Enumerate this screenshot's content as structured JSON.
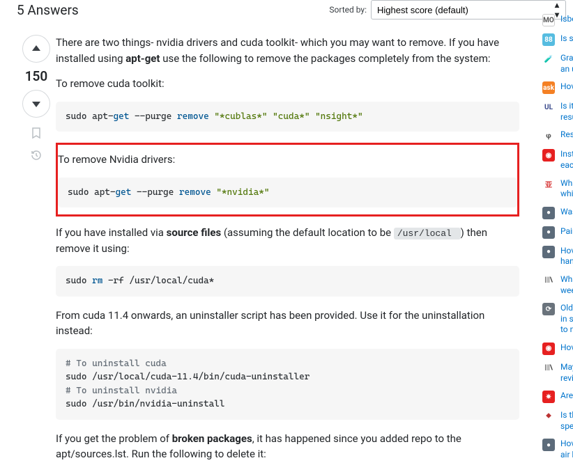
{
  "header": {
    "title": "5 Answers",
    "sort_label": "Sorted by:",
    "sort_value": "Highest score (default)"
  },
  "vote": {
    "count": "150"
  },
  "answer": {
    "p1a": "There are two things- nvidia drivers and cuda toolkit- which you may want to remove. If you have installed using ",
    "p1b": "apt-get",
    "p1c": " use the following to remove the packages completely from the system:",
    "p2": "To remove cuda toolkit:",
    "code1": "sudo apt-<blue>get</blue> --purge <kw>remove</kw> <str>\"*cublas*\"</str> <str>\"cuda*\"</str> <str>\"nsight*\"</str>",
    "p3": "To remove Nvidia drivers:",
    "code2": "sudo apt-<blue>get</blue> --purge <kw>remove</kw> <str>\"*nvidia*\"</str>",
    "p4a": "If you have installed via ",
    "p4b": "source files",
    "p4c": " (assuming the default location to be ",
    "p4code": " /usr/local ",
    "p4d": ") then remove it using:",
    "code3": "sudo <kw>rm</kw> -rf /usr/local/cuda*",
    "p5": "From cuda 11.4 onwards, an uninstaller script has been provided. Use it for the uninstallation instead:",
    "code4": "<cmt># To uninstall cuda</cmt>\nsudo /usr/local/cuda-11.4/bin/cuda-uninstaller\n<cmt># To uninstall nvidia</cmt>\nsudo /usr/bin/nvidia-uninstall",
    "p6a": "If you get the problem of ",
    "p6b": "broken packages",
    "p6c": ", it has happened since you added repo to the apt/sources.lst. Run the following to delete it:"
  },
  "related": [
    {
      "icon_bg": "#fff",
      "icon_border": "1px solid #ccc",
      "icon_fg": "#555",
      "icon_text": "MO",
      "l1": "Isbe",
      "l2": ""
    },
    {
      "icon_bg": "#56bce0",
      "icon_fg": "#fff",
      "icon_text": "88",
      "l1": "Is sa",
      "l2": ""
    },
    {
      "icon_bg": "#fff",
      "icon_fg": "#777",
      "icon_text": "🧪",
      "l1": "Gra",
      "l2": "an u"
    },
    {
      "icon_bg": "#f48024",
      "icon_fg": "#fff",
      "icon_text": "ask",
      "l1": "Hov",
      "l2": ""
    },
    {
      "icon_bg": "#fff",
      "icon_fg": "#3a4a8c",
      "icon_text": "UL",
      "l1": "Is it",
      "l2": "resu"
    },
    {
      "icon_bg": "#fff",
      "icon_fg": "#555",
      "icon_text": "φ",
      "l1": "Rese",
      "l2": ""
    },
    {
      "icon_bg": "#e62020",
      "icon_fg": "#fff",
      "icon_text": "◉",
      "l1": "Inst",
      "l2": "eacl"
    },
    {
      "icon_bg": "#fff",
      "icon_fg": "#d63333",
      "icon_text": "亚",
      "l1": "Wha",
      "l2": "whi"
    },
    {
      "icon_bg": "#5c6b7a",
      "icon_fg": "#fff",
      "icon_text": "●",
      "l1": "Was",
      "l2": ""
    },
    {
      "icon_bg": "#5c6b7a",
      "icon_fg": "#fff",
      "icon_text": "●",
      "l1": "Pair",
      "l2": ""
    },
    {
      "icon_bg": "#5c6b7a",
      "icon_fg": "#fff",
      "icon_text": "●",
      "l1": "Hov",
      "l2": "han"
    },
    {
      "icon_bg": "#fff",
      "icon_fg": "#444",
      "icon_text": "|||\\",
      "l1": "Wha",
      "l2": "wee"
    },
    {
      "icon_bg": "#6a737c",
      "icon_fg": "#fff",
      "icon_text": "⟳",
      "l1": "Old",
      "l2": "in se",
      "l3": "to n"
    },
    {
      "icon_bg": "#e62020",
      "icon_fg": "#fff",
      "icon_text": "◉",
      "l1": "Hov",
      "l2": ""
    },
    {
      "icon_bg": "#fff",
      "icon_fg": "#444",
      "icon_text": "|||\\",
      "l1": "May",
      "l2": "revi"
    },
    {
      "icon_bg": "#e62020",
      "icon_fg": "#fff",
      "icon_text": "✷",
      "l1": "Are",
      "l2": ""
    },
    {
      "icon_bg": "#fff",
      "icon_fg": "#b33",
      "icon_text": "⯁",
      "l1": "Is th",
      "l2": "spe"
    },
    {
      "icon_bg": "#5c6b7a",
      "icon_fg": "#fff",
      "icon_text": "●",
      "l1": "Hov",
      "l2": "air b"
    }
  ]
}
